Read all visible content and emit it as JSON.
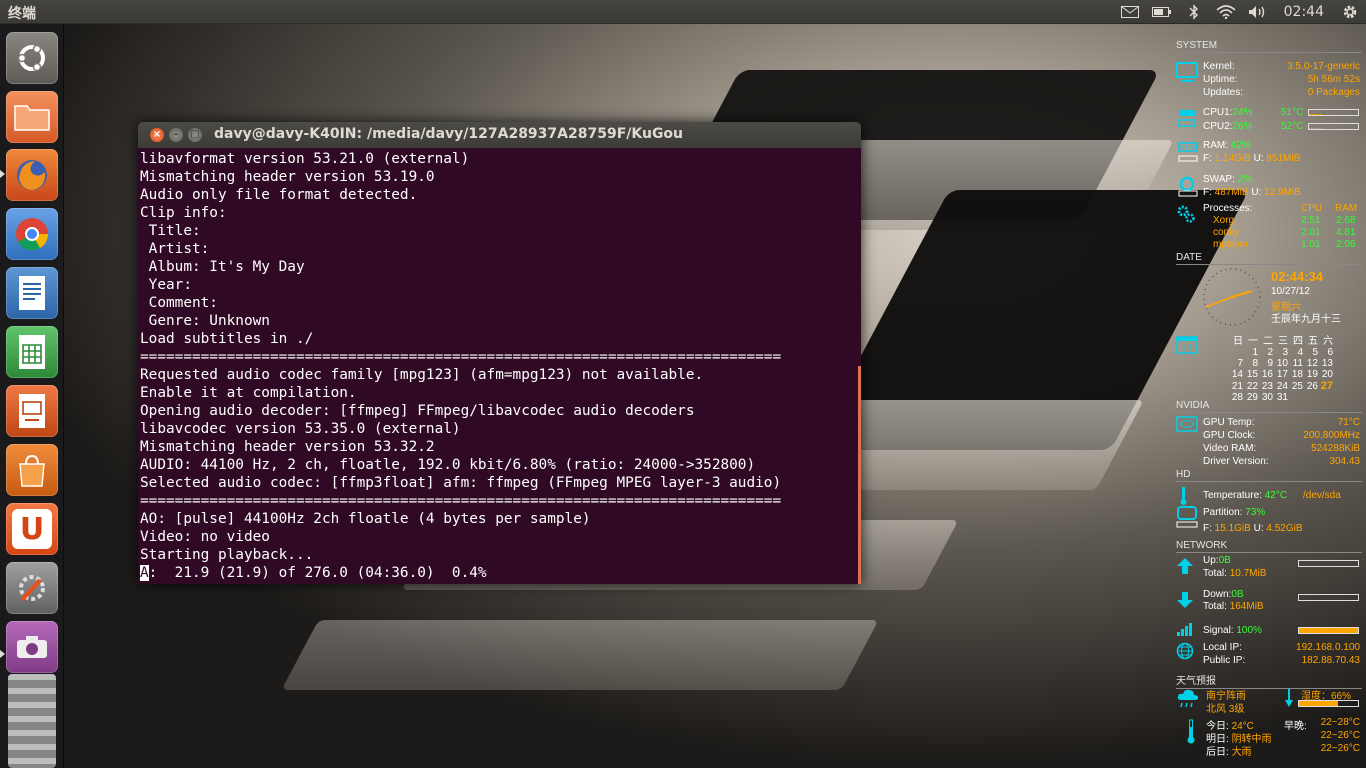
{
  "topbar": {
    "app_title": "终端",
    "clock": "02:44",
    "icons": [
      "mail-icon",
      "battery-icon",
      "bluetooth-icon",
      "wifi-icon",
      "volume-icon",
      "gear-icon"
    ]
  },
  "launcher": {
    "items": [
      {
        "name": "dash-home",
        "color": "#7d7a75"
      },
      {
        "name": "files",
        "color": "#e8743b"
      },
      {
        "name": "firefox",
        "color": "#e6611f"
      },
      {
        "name": "chrome",
        "color": "#4b8ad6"
      },
      {
        "name": "writer",
        "color": "#3c7cc2"
      },
      {
        "name": "calc",
        "color": "#3ea34a"
      },
      {
        "name": "impress",
        "color": "#d8541d"
      },
      {
        "name": "software-center",
        "color": "#e36e20"
      },
      {
        "name": "ubuntu-one",
        "color": "#dd4814"
      },
      {
        "name": "system-settings",
        "color": "#8a8a8a"
      },
      {
        "name": "screenshot",
        "color": "#9b4ca0"
      }
    ],
    "ubuntu_one_letter": "U"
  },
  "terminal": {
    "title": "davy@davy-K40IN: /media/davy/127A28937A28759F/KuGou",
    "lines": [
      "libavformat version 53.21.0 (external)",
      "Mismatching header version 53.19.0",
      "Audio only file format detected.",
      "Clip info:",
      " Title: ",
      " Artist: ",
      " Album: It's My Day",
      " Year: ",
      " Comment: ",
      " Genre: Unknown",
      "Load subtitles in ./",
      "==========================================================================",
      "Requested audio codec family [mpg123] (afm=mpg123) not available.",
      "Enable it at compilation.",
      "Opening audio decoder: [ffmpeg] FFmpeg/libavcodec audio decoders",
      "libavcodec version 53.35.0 (external)",
      "Mismatching header version 53.32.2",
      "AUDIO: 44100 Hz, 2 ch, floatle, 192.0 kbit/6.80% (ratio: 24000->352800)",
      "Selected audio codec: [ffmp3float] afm: ffmpeg (FFmpeg MPEG layer-3 audio)",
      "==========================================================================",
      "AO: [pulse] 44100Hz 2ch floatle (4 bytes per sample)",
      "Video: no video",
      "Starting playback...",
      "A:  21.9 (21.9) of 276.0 (04:36.0)  0.4%"
    ]
  },
  "conky": {
    "system": {
      "header": "SYSTEM",
      "kernel_label": "Kernel:",
      "kernel": "3.5.0-17-generic",
      "uptime_label": "Uptime:",
      "uptime": "5h 56m 52s",
      "updates_label": "Updates:",
      "updates": "0 Packages",
      "cpu1_label": "CPU1:",
      "cpu1": "24%",
      "cpu1_temp": "51°C",
      "cpu2_label": "CPU2:",
      "cpu2": "26%",
      "cpu2_temp": "52°C",
      "ram_label": "RAM:",
      "ram": "42%",
      "ram_f_label": "F:",
      "ram_free": "1.14GiB",
      "ram_u_label": "U:",
      "ram_used": "851MiB",
      "swap_label": "SWAP:",
      "swap": "2%",
      "swap_f_label": "F:",
      "swap_free": "487MiB",
      "swap_u_label": "U:",
      "swap_used": "12.9MiB",
      "proc_label": "Processes:",
      "proc_cpu_h": "CPU",
      "proc_ram_h": "RAM",
      "procs": [
        {
          "name": "Xorg",
          "cpu": "2.51",
          "ram": "2.68"
        },
        {
          "name": "conky",
          "cpu": "2.01",
          "ram": "4.81"
        },
        {
          "name": "mplayer",
          "cpu": "1.01",
          "ram": "2.06"
        }
      ]
    },
    "date": {
      "header": "DATE",
      "time": "02:44:34",
      "date": "10/27/12",
      "weekday": "星期六",
      "lunar": "壬辰年九月十三",
      "cal_day": "27",
      "week_heads": [
        "日",
        "一",
        "二",
        "三",
        "四",
        "五",
        "六"
      ],
      "weeks": [
        [
          "",
          "1",
          "2",
          "3",
          "4",
          "5",
          "6"
        ],
        [
          "7",
          "8",
          "9",
          "10",
          "11",
          "12",
          "13"
        ],
        [
          "14",
          "15",
          "16",
          "17",
          "18",
          "19",
          "20"
        ],
        [
          "21",
          "22",
          "23",
          "24",
          "25",
          "26",
          "27"
        ],
        [
          "28",
          "29",
          "30",
          "31",
          "",
          "",
          ""
        ]
      ]
    },
    "nvidia": {
      "header": "NVIDIA",
      "temp_label": "GPU Temp:",
      "temp": "71°C",
      "clock_label": "GPU Clock:",
      "clock": "200,800MHz",
      "vram_label": "Video RAM:",
      "vram": "524288KiB",
      "driver_label": "Driver Version:",
      "driver": "304.43"
    },
    "hd": {
      "header": "HD",
      "temp_label": "Temperature:",
      "temp": "42°C",
      "dev": "/dev/sda",
      "part_label": "Partition:",
      "part": "73%",
      "f_label": "F:",
      "free": "15.1GiB",
      "u_label": "U:",
      "used": "4.52GiB"
    },
    "network": {
      "header": "NETWORK",
      "up_label": "Up:",
      "up": "0B",
      "up_total_label": "Total:",
      "up_total": "10.7MiB",
      "down_label": "Down:",
      "down": "0B",
      "down_total_label": "Total:",
      "down_total": "164MiB",
      "signal_label": "Signal:",
      "signal": "100%",
      "local_label": "Local IP:",
      "local": "192.168.0.100",
      "public_label": "Public IP:",
      "public": "182.88.70.43"
    },
    "weather": {
      "header": "天气预报",
      "cond": "南宁阵雨",
      "wind": "北风 3级",
      "hum_label": "湿度：",
      "hum": "66%",
      "today_label": "今日:",
      "today": "24°C",
      "tomorrow_label": "明日:",
      "tomorrow": "阴转中雨",
      "after_label": "后日:",
      "after": "大雨",
      "range_label": "早晚:",
      "r1": "22~28°C",
      "r2": "22~26°C",
      "r3": "22~26°C"
    }
  }
}
